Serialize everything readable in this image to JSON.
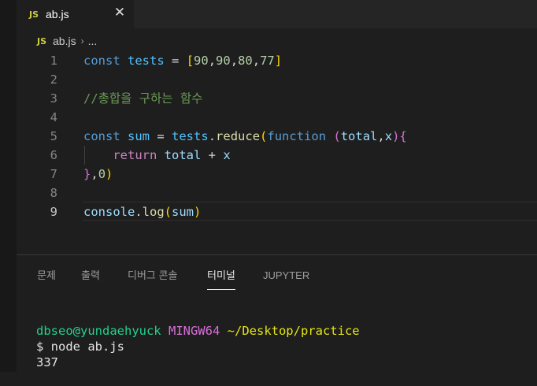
{
  "tab": {
    "lang_badge": "JS",
    "file_name": "ab.js",
    "close_glyph": "✕"
  },
  "breadcrumb": {
    "lang_badge": "JS",
    "file": "ab.js",
    "separator": "›",
    "ellipsis": "..."
  },
  "editor": {
    "line_numbers": [
      "1",
      "2",
      "3",
      "4",
      "5",
      "6",
      "7",
      "8",
      "9"
    ],
    "active_line": 9,
    "lines": [
      [
        {
          "t": "const",
          "c": "kw"
        },
        {
          "t": " "
        },
        {
          "t": "tests",
          "c": "var"
        },
        {
          "t": " = ",
          "c": "op"
        },
        {
          "t": "[",
          "c": "b1"
        },
        {
          "t": "90",
          "c": "num"
        },
        {
          "t": ",",
          "c": "op"
        },
        {
          "t": "90",
          "c": "num"
        },
        {
          "t": ",",
          "c": "op"
        },
        {
          "t": "80",
          "c": "num"
        },
        {
          "t": ",",
          "c": "op"
        },
        {
          "t": "77",
          "c": "num"
        },
        {
          "t": "]",
          "c": "b1"
        }
      ],
      [],
      [
        {
          "t": "//총합을 구하는 함수",
          "c": "cm"
        }
      ],
      [],
      [
        {
          "t": "const",
          "c": "kw"
        },
        {
          "t": " "
        },
        {
          "t": "sum",
          "c": "var"
        },
        {
          "t": " = ",
          "c": "op"
        },
        {
          "t": "tests",
          "c": "var"
        },
        {
          "t": ".",
          "c": "op"
        },
        {
          "t": "reduce",
          "c": "fn"
        },
        {
          "t": "(",
          "c": "b1"
        },
        {
          "t": "function",
          "c": "kw"
        },
        {
          "t": " "
        },
        {
          "t": "(",
          "c": "b2"
        },
        {
          "t": "total",
          "c": "prop"
        },
        {
          "t": ",",
          "c": "op"
        },
        {
          "t": "x",
          "c": "prop"
        },
        {
          "t": ")",
          "c": "b2"
        },
        {
          "t": "{",
          "c": "b2"
        }
      ],
      [
        {
          "t": "    "
        },
        {
          "t": "return",
          "c": "ctl"
        },
        {
          "t": " "
        },
        {
          "t": "total",
          "c": "prop"
        },
        {
          "t": " + ",
          "c": "op"
        },
        {
          "t": "x",
          "c": "prop"
        }
      ],
      [
        {
          "t": "}",
          "c": "b2"
        },
        {
          "t": ",",
          "c": "op"
        },
        {
          "t": "0",
          "c": "num"
        },
        {
          "t": ")",
          "c": "b1"
        }
      ],
      [],
      [
        {
          "t": "console",
          "c": "prop"
        },
        {
          "t": ".",
          "c": "op"
        },
        {
          "t": "log",
          "c": "fn"
        },
        {
          "t": "(",
          "c": "b1"
        },
        {
          "t": "sum",
          "c": "prop"
        },
        {
          "t": ")",
          "c": "b1"
        }
      ]
    ]
  },
  "panel": {
    "tabs": [
      "문제",
      "출력",
      "디버그 콘솔",
      "터미널",
      "JUPYTER"
    ],
    "active_tab": "터미널"
  },
  "terminal": {
    "user_host": "dbseo@yundaehyuck",
    "env": "MINGW64",
    "path": "~/Desktop/practice",
    "prompt": "$ node ab.js",
    "output": "337"
  }
}
